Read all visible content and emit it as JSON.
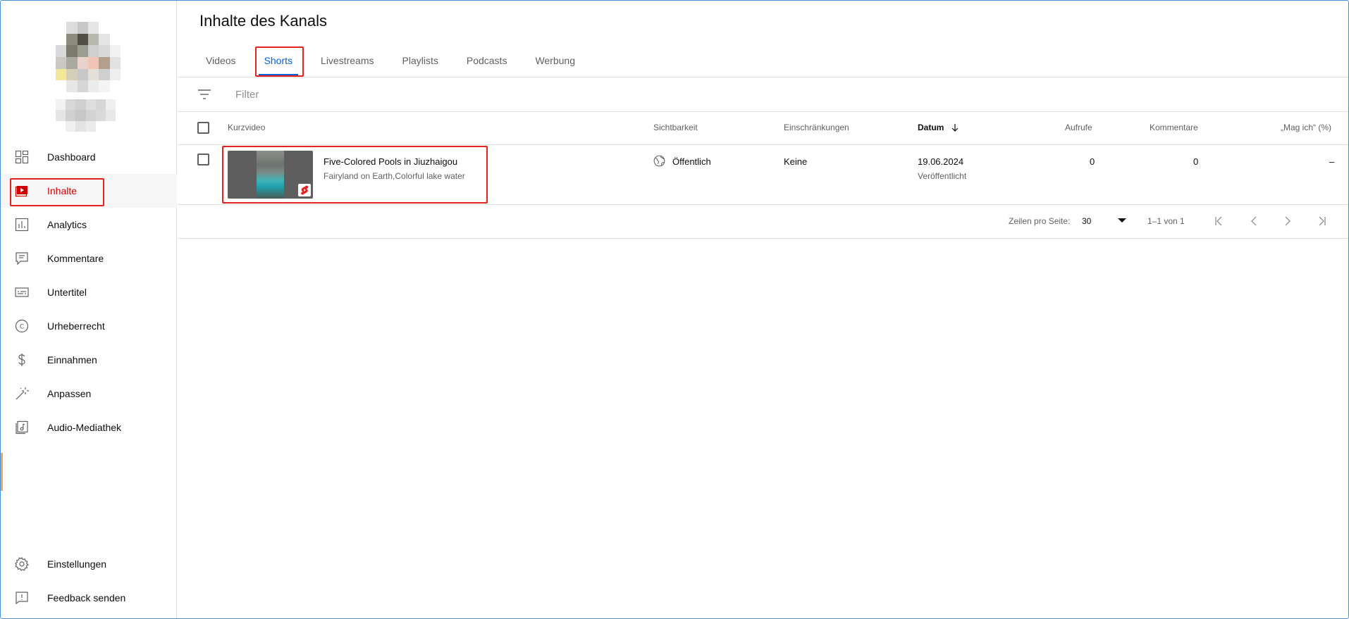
{
  "sidebar": {
    "items": [
      {
        "label": "Dashboard",
        "icon": "dashboard-icon"
      },
      {
        "label": "Inhalte",
        "icon": "content-icon",
        "active": true
      },
      {
        "label": "Analytics",
        "icon": "analytics-icon"
      },
      {
        "label": "Kommentare",
        "icon": "comments-icon"
      },
      {
        "label": "Untertitel",
        "icon": "subtitles-icon"
      },
      {
        "label": "Urheberrecht",
        "icon": "copyright-icon"
      },
      {
        "label": "Einnahmen",
        "icon": "dollar-icon"
      },
      {
        "label": "Anpassen",
        "icon": "magic-wand-icon"
      },
      {
        "label": "Audio-Mediathek",
        "icon": "audio-library-icon"
      }
    ],
    "bottom_items": [
      {
        "label": "Einstellungen",
        "icon": "gear-icon"
      },
      {
        "label": "Feedback senden",
        "icon": "feedback-icon"
      }
    ]
  },
  "main": {
    "title": "Inhalte des Kanals",
    "tabs": [
      {
        "label": "Videos"
      },
      {
        "label": "Shorts",
        "active": true
      },
      {
        "label": "Livestreams"
      },
      {
        "label": "Playlists"
      },
      {
        "label": "Podcasts"
      },
      {
        "label": "Werbung"
      }
    ],
    "filter": {
      "placeholder": "Filter",
      "icon": "filter-icon"
    },
    "columns": {
      "video": "Kurzvideo",
      "visibility": "Sichtbarkeit",
      "restrictions": "Einschränkungen",
      "date": "Datum",
      "views": "Aufrufe",
      "comments": "Kommentare",
      "likes": "„Mag ich“ (%)"
    },
    "rows": [
      {
        "title": "Five-Colored Pools in Jiuzhaigou",
        "description": "Fairyland on Earth,Colorful lake water",
        "visibility": "Öffentlich",
        "restrictions": "Keine",
        "date": "19.06.2024",
        "date_status": "Veröffentlicht",
        "views": "0",
        "comments": "0",
        "likes": "–"
      }
    ],
    "pagination": {
      "rows_per_page_label": "Zeilen pro Seite:",
      "rows_per_page": "30",
      "range": "1–1 von 1"
    }
  },
  "colors": {
    "accent_red": "#cc0000",
    "tab_blue": "#065fd4",
    "highlight_box": "#e32222"
  }
}
